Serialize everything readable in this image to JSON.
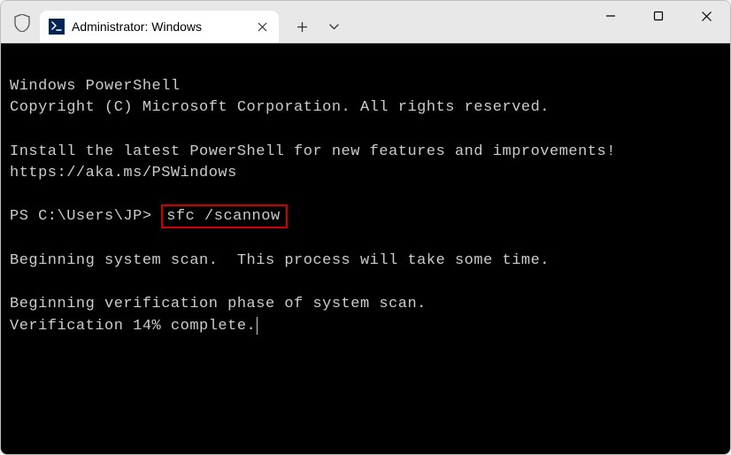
{
  "titlebar": {
    "tab_title": "Administrator: Windows",
    "powershell_icon_symbol": ">_"
  },
  "terminal": {
    "line1": "Windows PowerShell",
    "line2": "Copyright (C) Microsoft Corporation. All rights reserved.",
    "line3": "",
    "line4": "Install the latest PowerShell for new features and improvements!",
    "line5": "https://aka.ms/PSWindows",
    "line6": "",
    "prompt": "PS C:\\Users\\JP> ",
    "command": "sfc /scannow",
    "line8": "",
    "line9": "Beginning system scan.  This process will take some time.",
    "line10": "",
    "line11": "Beginning verification phase of system scan.",
    "line12": "Verification 14% complete."
  }
}
